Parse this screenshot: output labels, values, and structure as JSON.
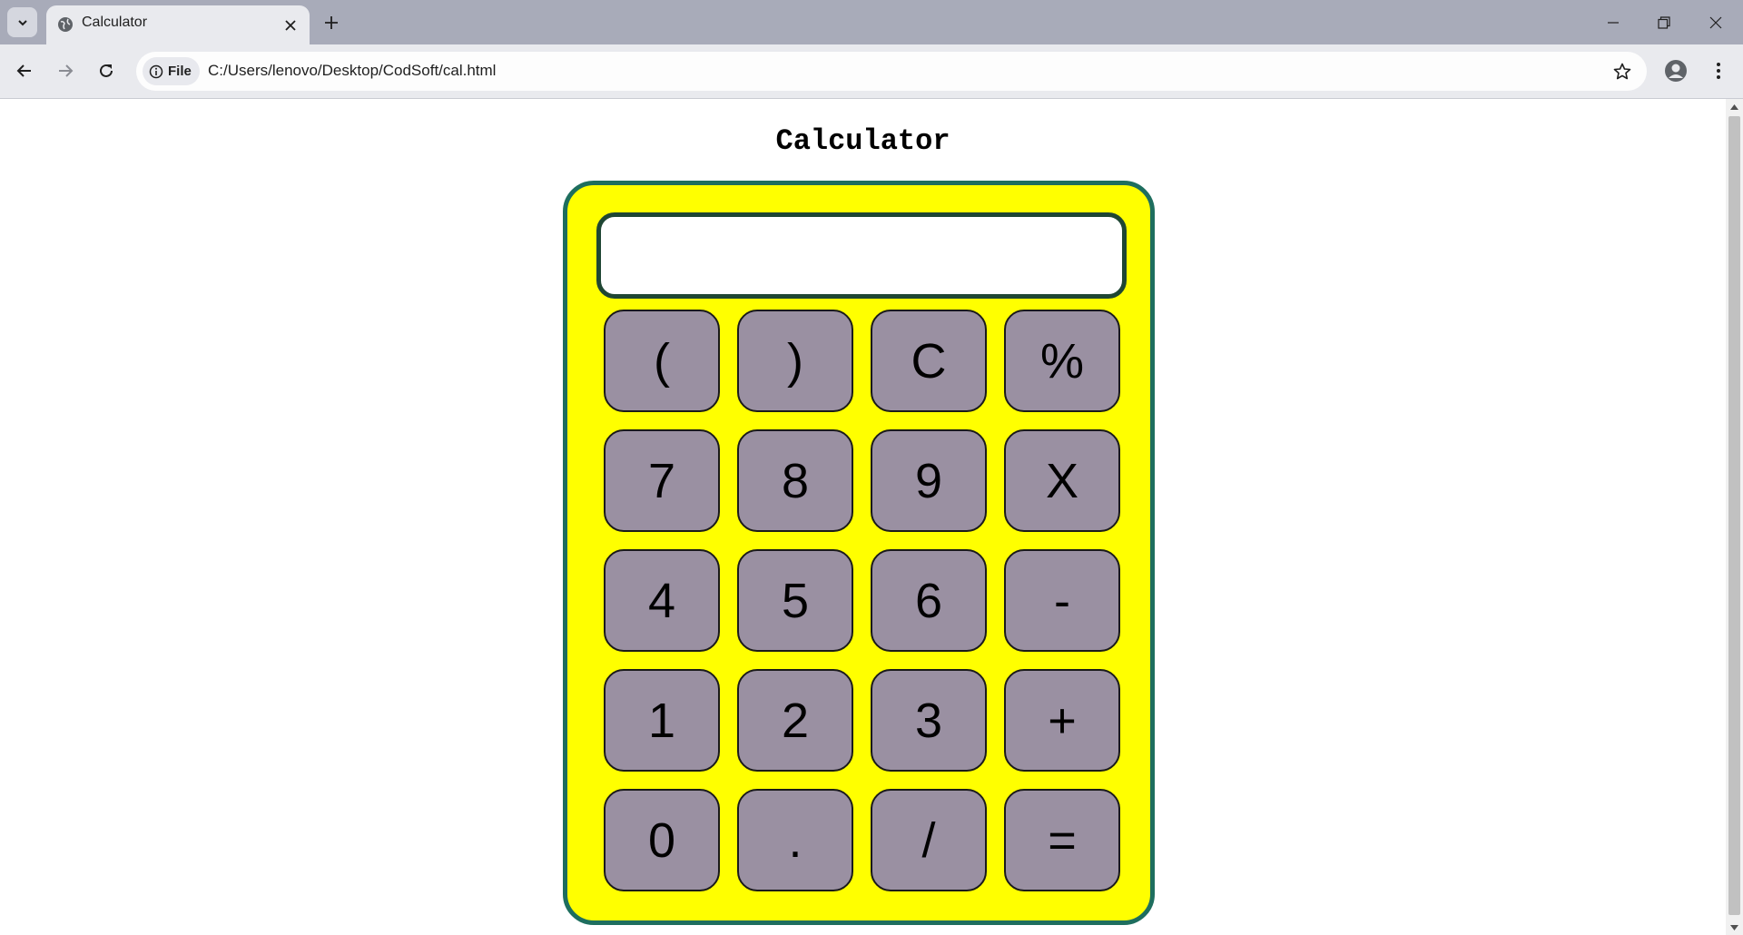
{
  "browser": {
    "tab_title": "Calculator",
    "site_chip_label": "File",
    "url": "C:/Users/lenovo/Desktop/CodSoft/cal.html",
    "icons": {
      "tab_list": "chevron-down-icon",
      "favicon": "globe-icon",
      "tab_close": "close-icon",
      "new_tab": "plus-icon",
      "minimize": "minimize-icon",
      "restore": "restore-icon",
      "close_window": "close-icon",
      "back": "arrow-left-icon",
      "forward": "arrow-right-icon",
      "reload": "reload-icon",
      "site_info": "info-icon",
      "bookmark": "star-icon",
      "profile": "profile-icon",
      "menu": "kebab-menu-icon"
    }
  },
  "page": {
    "title": "Calculator",
    "display_value": ""
  },
  "calculator": {
    "keys": [
      "(",
      ")",
      "C",
      "%",
      "7",
      "8",
      "9",
      "X",
      "4",
      "5",
      "6",
      "-",
      "1",
      "2",
      "3",
      "+",
      "0",
      ".",
      "/",
      "="
    ]
  },
  "colors": {
    "calculator_body": "#ffff00",
    "calculator_border": "#1e6e5e",
    "key_background": "#9a90a2",
    "display_border": "#1f4633"
  }
}
